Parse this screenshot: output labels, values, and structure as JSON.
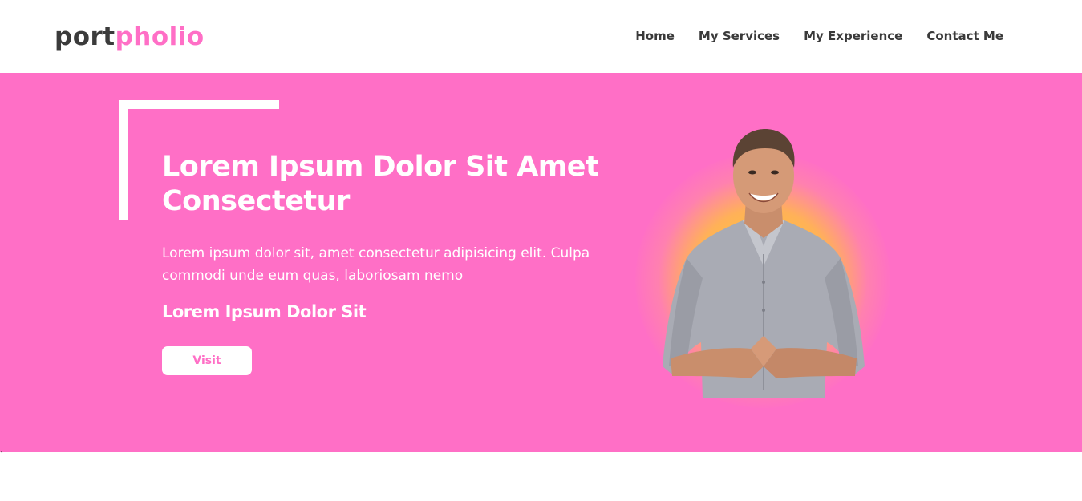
{
  "brand": {
    "part1": "port",
    "part2": "pholio",
    "accent": "#ff6fc6",
    "dark": "#3b3b3b"
  },
  "nav": {
    "items": [
      {
        "label": "Home"
      },
      {
        "label": "My Services"
      },
      {
        "label": "My Experience"
      },
      {
        "label": "Contact Me"
      }
    ]
  },
  "hero": {
    "background": "#ff6fc6",
    "title": "Lorem Ipsum Dolor Sit Amet Consectetur",
    "text": "Lorem ipsum dolor sit, amet consectetur adipisicing elit. Culpa commodi unde eum quas, laboriosam nemo",
    "subtitle": "Lorem Ipsum Dolor Sit",
    "button_label": "Visit"
  },
  "footer_mark": "`"
}
